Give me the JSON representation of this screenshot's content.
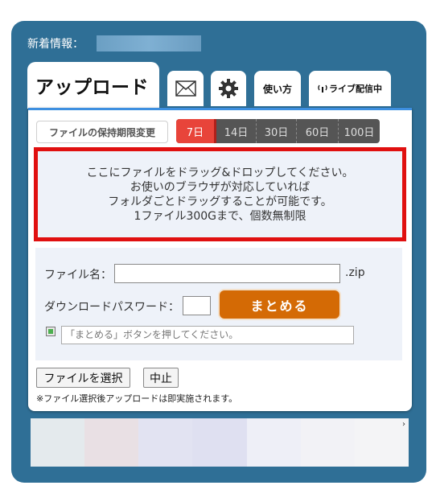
{
  "header": {
    "news_label": "新着情報："
  },
  "tabs": {
    "upload": "アップロード",
    "help": "使い方",
    "live": "ライブ配信中",
    "live_icon": "broadcast-icon",
    "mail_icon": "mail-icon",
    "gear_icon": "gear-icon"
  },
  "retention": {
    "button_label": "ファイルの保持期限変更",
    "options": [
      "7日",
      "14日",
      "30日",
      "60日",
      "100日"
    ],
    "selected": "7日"
  },
  "dropzone": {
    "lines": [
      "ここにファイルをドラッグ&ドロップしてください。",
      "お使いのブラウザが対応していれば",
      "フォルダごとドラッグすることが可能です。",
      "1ファイル300Gまで、個数無制限"
    ]
  },
  "form": {
    "filename_label": "ファイル名：",
    "filename_value": "",
    "zip_suffix": ".zip",
    "password_label": "ダウンロードパスワード：",
    "password_value": "",
    "bundle_button": "まとめる",
    "status_placeholder": "「まとめる」ボタンを押してください。"
  },
  "actions": {
    "select_file": "ファイルを選択",
    "stop": "中止",
    "footnote": "※ファイル選択後アップロードは即実施されます。"
  },
  "colors": {
    "frame": "#2f6f96",
    "accent_red": "#e8443a",
    "bundle_orange": "#d46a05",
    "dropzone_border": "#e01010"
  }
}
